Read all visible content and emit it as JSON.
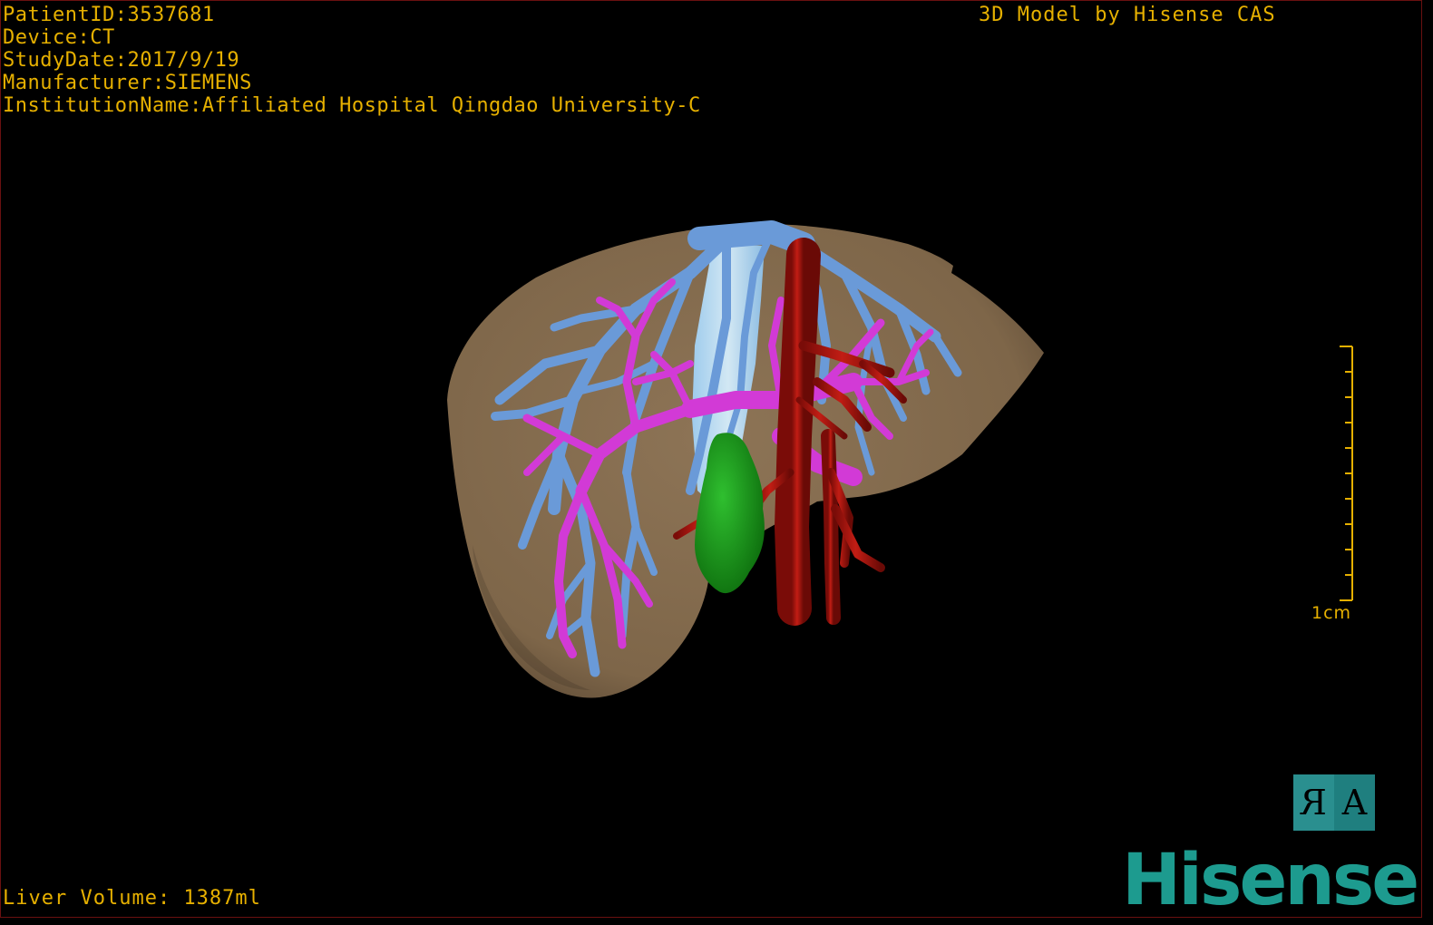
{
  "patient_info": [
    {
      "label": "PatientID:",
      "value": "3537681"
    },
    {
      "label": "Device:",
      "value": "CT"
    },
    {
      "label": "StudyDate:",
      "value": "2017/9/19"
    },
    {
      "label": "Manufacturer:",
      "value": "SIEMENS"
    },
    {
      "label": "InstitutionName:",
      "value": "Affiliated Hospital Qingdao University-C"
    }
  ],
  "title": "3D Model by Hisense CAS",
  "volume_text": "Liver Volume: 1387ml",
  "scale": {
    "label": "1cm",
    "ticks": 10
  },
  "orientation": {
    "left_glyph": "R",
    "right_glyph": "A"
  },
  "brand": "Hisense",
  "structures": {
    "liver": {
      "color": "#8a7152"
    },
    "hepatic_vein": {
      "color": "#6a9ad8"
    },
    "portal_vein": {
      "color": "#d23ad6"
    },
    "artery": {
      "color": "#b0150e"
    },
    "gallbladder": {
      "color": "#169a16"
    },
    "ivc": {
      "color": "#a8d0f0"
    }
  },
  "colors": {
    "overlay_text": "#e6b000",
    "brand": "#1d9b8f",
    "orient_box": "#1f7f7f",
    "border": "#6a1010"
  }
}
